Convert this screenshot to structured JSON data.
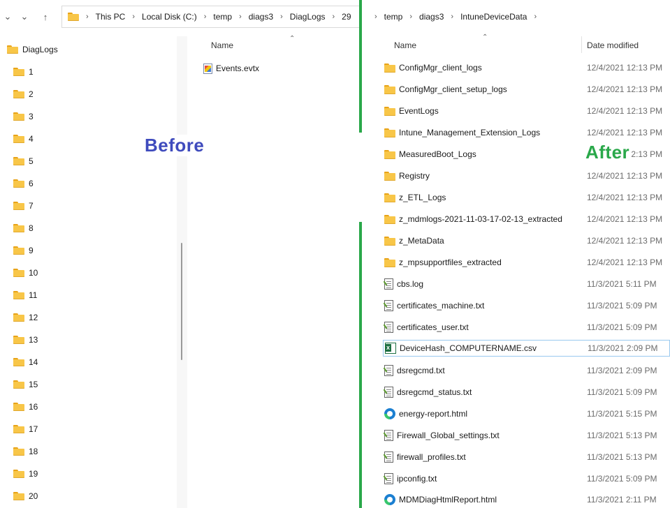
{
  "left": {
    "address_parts": [
      "This PC",
      "Local Disk (C:)",
      "temp",
      "diags3",
      "DiagLogs",
      "29"
    ],
    "tree_root": "DiagLogs",
    "tree_items": [
      "1",
      "2",
      "3",
      "4",
      "5",
      "6",
      "7",
      "8",
      "9",
      "10",
      "11",
      "12",
      "13",
      "14",
      "15",
      "16",
      "17",
      "18",
      "19",
      "20"
    ],
    "column_name": "Name",
    "files": [
      "Events.evtx"
    ],
    "label": "Before"
  },
  "right": {
    "address_parts": [
      "temp",
      "diags3",
      "IntuneDeviceData"
    ],
    "column_name": "Name",
    "column_date": "Date modified",
    "label": "After",
    "rows": [
      {
        "name": "ConfigMgr_client_logs",
        "date": "12/4/2021 12:13 PM",
        "icon": "folder-icon"
      },
      {
        "name": "ConfigMgr_client_setup_logs",
        "date": "12/4/2021 12:13 PM",
        "icon": "folder-icon"
      },
      {
        "name": "EventLogs",
        "date": "12/4/2021 12:13 PM",
        "icon": "folder-icon"
      },
      {
        "name": "Intune_Management_Extension_Logs",
        "date": "12/4/2021 12:13 PM",
        "icon": "folder-icon"
      },
      {
        "name": "MeasuredBoot_Logs",
        "date": "12/4/2021 12:13 PM",
        "icon": "folder-icon"
      },
      {
        "name": "Registry",
        "date": "12/4/2021 12:13 PM",
        "icon": "folder-icon"
      },
      {
        "name": "z_ETL_Logs",
        "date": "12/4/2021 12:13 PM",
        "icon": "folder-icon"
      },
      {
        "name": "z_mdmlogs-2021-11-03-17-02-13_extracted",
        "date": "12/4/2021 12:13 PM",
        "icon": "folder-icon"
      },
      {
        "name": "z_MetaData",
        "date": "12/4/2021 12:13 PM",
        "icon": "folder-icon"
      },
      {
        "name": "z_mpsupportfiles_extracted",
        "date": "12/4/2021 12:13 PM",
        "icon": "folder-icon"
      },
      {
        "name": "cbs.log",
        "date": "11/3/2021 5:11 PM",
        "icon": "text-file-icon"
      },
      {
        "name": "certificates_machine.txt",
        "date": "11/3/2021 5:09 PM",
        "icon": "text-file-icon"
      },
      {
        "name": "certificates_user.txt",
        "date": "11/3/2021 5:09 PM",
        "icon": "text-file-icon"
      },
      {
        "name": "DeviceHash_COMPUTERNAME.csv",
        "date": "11/3/2021 2:09 PM",
        "icon": "excel-file-icon"
      },
      {
        "name": "dsregcmd.txt",
        "date": "11/3/2021 2:09 PM",
        "icon": "text-file-icon"
      },
      {
        "name": "dsregcmd_status.txt",
        "date": "11/3/2021 5:09 PM",
        "icon": "text-file-icon"
      },
      {
        "name": "energy-report.html",
        "date": "11/3/2021 5:15 PM",
        "icon": "edge-html-icon"
      },
      {
        "name": "Firewall_Global_settings.txt",
        "date": "11/3/2021 5:13 PM",
        "icon": "text-file-icon"
      },
      {
        "name": "firewall_profiles.txt",
        "date": "11/3/2021 5:13 PM",
        "icon": "text-file-icon"
      },
      {
        "name": "ipconfig.txt",
        "date": "11/3/2021 5:09 PM",
        "icon": "text-file-icon"
      },
      {
        "name": "MDMDiagHtmlReport.html",
        "date": "11/3/2021 2:11 PM",
        "icon": "edge-html-icon"
      }
    ]
  },
  "colors": {
    "before_label": "#3f4bbd",
    "after_label": "#2aa84a",
    "divider": "#2aa84a",
    "folder": "#f8c648"
  }
}
